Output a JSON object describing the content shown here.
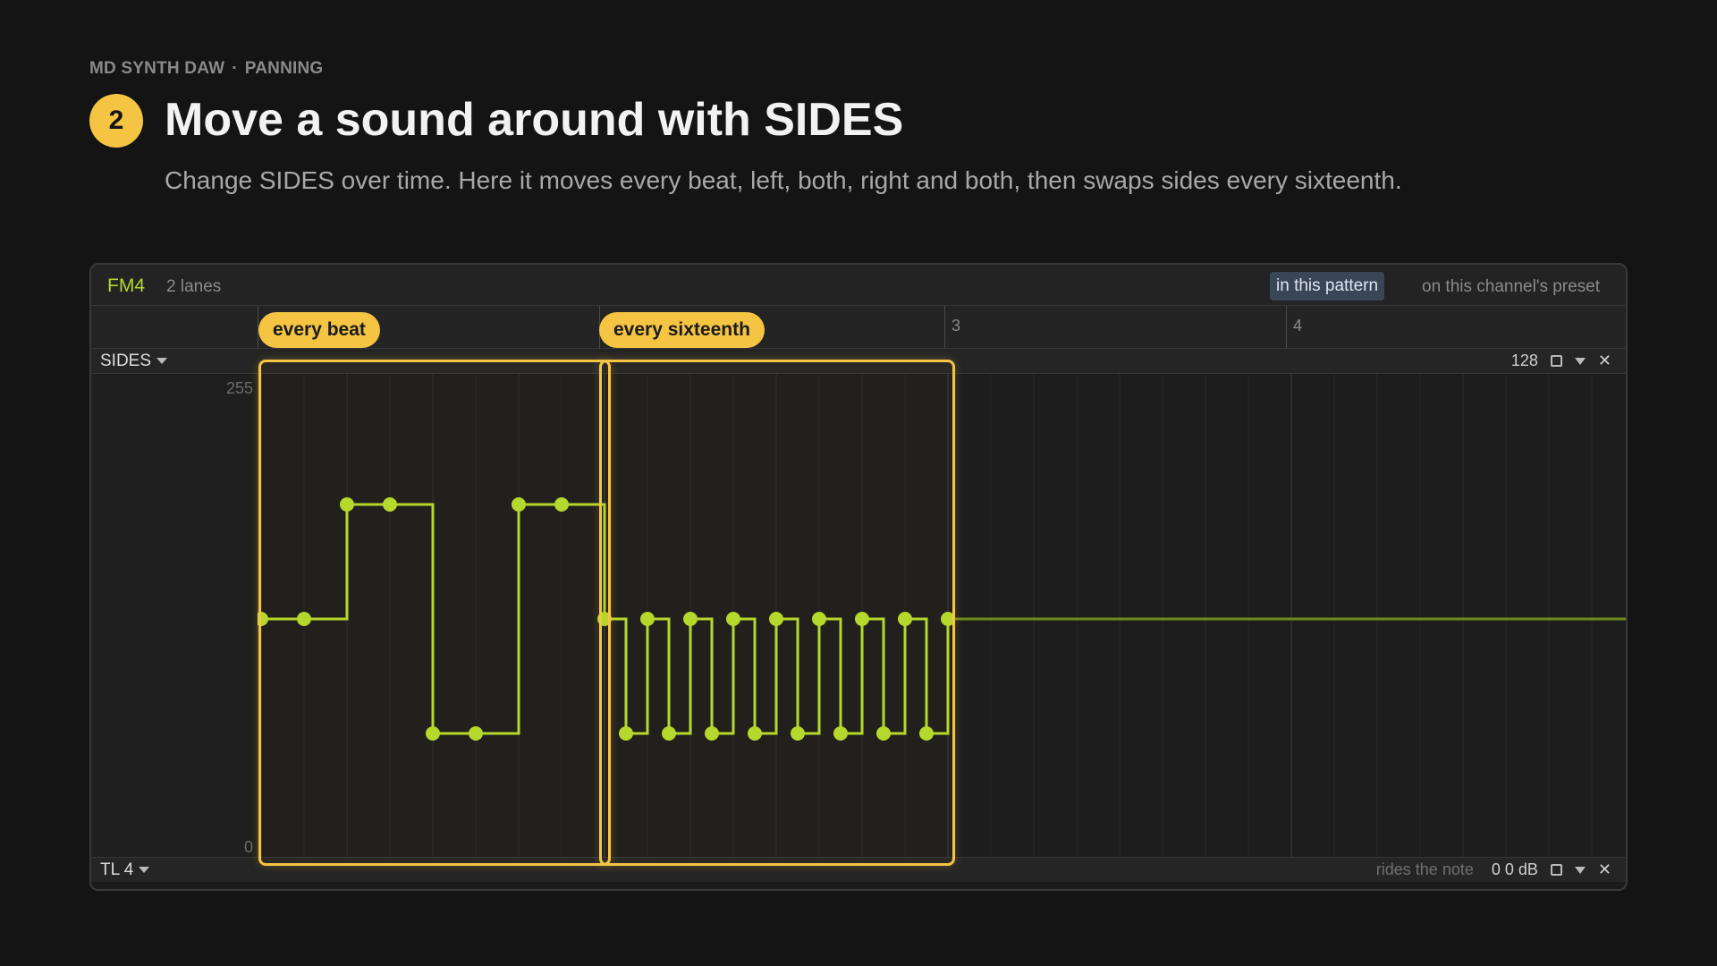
{
  "breadcrumb": {
    "app": "MD SYNTH DAW",
    "separator": "·",
    "section": "PANNING"
  },
  "step": {
    "number": "2",
    "title": "Move a sound around with SIDES",
    "subtitle": "Change SIDES over time. Here it moves every beat, left, both, right and both, then swaps sides every sixteenth."
  },
  "panel": {
    "track": "FM4",
    "lanes": "2 lanes",
    "scope_active": "in this pattern",
    "scope_other": "on this channel's preset",
    "ruler_marks": [
      "3",
      "4"
    ],
    "lane": {
      "name": "SIDES",
      "value": "128",
      "range_top": "255",
      "range_bottom": "0"
    },
    "bottom_lane": {
      "name": "TL 4",
      "note": "rides the note",
      "value": "0 0 dB"
    },
    "callouts": {
      "first": "every beat",
      "second": "every sixteenth"
    }
  },
  "colors": {
    "accent": "#f5c443",
    "automation": "#b5d82c",
    "track": "#b5d82c"
  },
  "automation": {
    "range": [
      0,
      255
    ],
    "every_beat": [
      128,
      128,
      192,
      192,
      64,
      64,
      192,
      192
    ],
    "every_sixteenth": [
      128,
      64,
      128,
      64,
      128,
      64,
      128,
      64,
      128,
      64,
      128,
      64,
      128,
      64,
      128,
      64,
      128
    ],
    "after": 128
  }
}
